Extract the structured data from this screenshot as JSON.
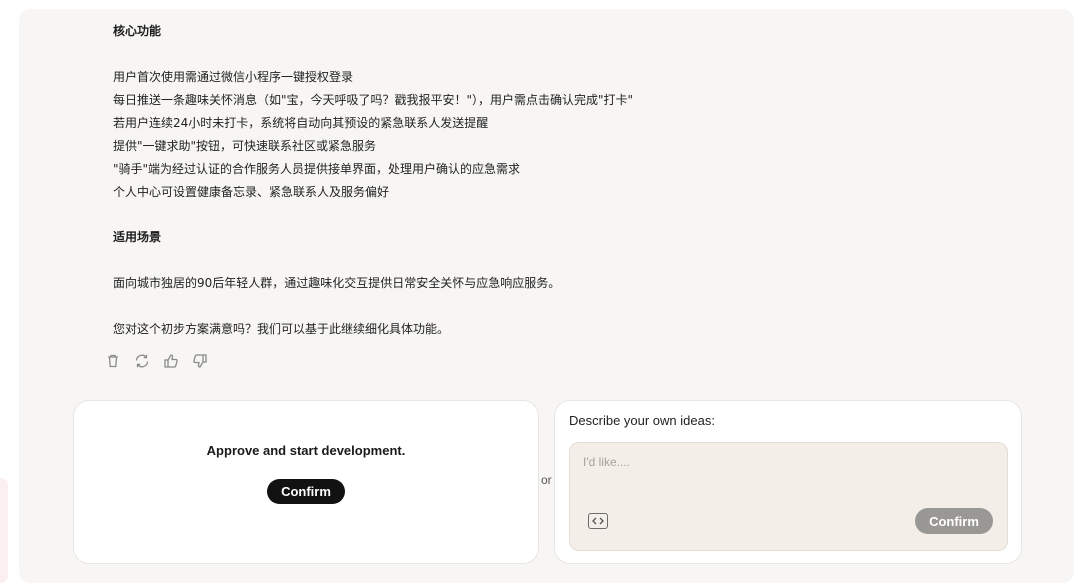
{
  "message": {
    "section1_heading": "核心功能",
    "features": [
      "用户首次使用需通过微信小程序一键授权登录",
      "每日推送一条趣味关怀消息（如\"宝，今天呼吸了吗？戳我报平安！\"），用户需点击确认完成\"打卡\"",
      "若用户连续24小时未打卡，系统将自动向其预设的紧急联系人发送提醒",
      "提供\"一键求助\"按钮，可快速联系社区或紧急服务",
      "\"骑手\"端为经过认证的合作服务人员提供接单界面，处理用户确认的应急需求",
      "个人中心可设置健康备忘录、紧急联系人及服务偏好"
    ],
    "section2_heading": "适用场景",
    "scenario": "面向城市独居的90后年轻人群，通过趣味化交互提供日常安全关怀与应急响应服务。",
    "closing": "您对这个初步方案满意吗？我们可以基于此继续细化具体功能。"
  },
  "actions": {
    "icons": [
      "trash-icon",
      "refresh-icon",
      "thumbs-up-icon",
      "thumbs-down-icon"
    ]
  },
  "approve_card": {
    "text": "Approve and start development.",
    "button_label": "Confirm"
  },
  "separator": "or",
  "ideas_card": {
    "label": "Describe your own ideas:",
    "placeholder": "I'd like....",
    "button_label": "Confirm"
  }
}
